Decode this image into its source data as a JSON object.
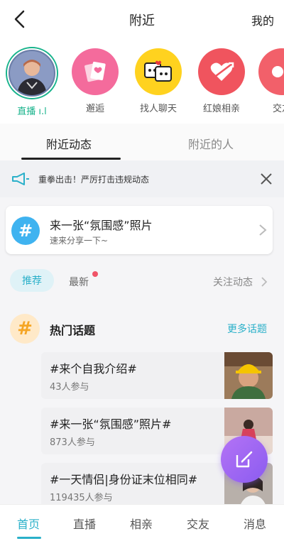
{
  "header": {
    "title": "附近",
    "mine_label": "我的"
  },
  "stories": [
    {
      "label": "直播 ı.l",
      "icon": "live-avatar"
    },
    {
      "label": "邂逅",
      "icon": "cards-icon"
    },
    {
      "label": "找人聊天",
      "icon": "chat-bubbles-icon"
    },
    {
      "label": "红娘相亲",
      "icon": "arrow-heart-icon"
    },
    {
      "label": "交友",
      "icon": "friends-icon"
    }
  ],
  "tabs": {
    "nearby_posts": "附近动态",
    "nearby_people": "附近的人"
  },
  "notice": {
    "text": "重拳出击！严厉打击违规动态"
  },
  "promo": {
    "title": "来一张“氛围感”照片",
    "subtitle": "速来分享一下~"
  },
  "filters": {
    "recommend": "推荐",
    "latest": "最新",
    "follow": "关注动态"
  },
  "hot_topics": {
    "title": "热门话题",
    "more": "更多话题",
    "items": [
      {
        "name": "#来个自我介绍#",
        "count": "43人参与"
      },
      {
        "name": "#来一张“氛围感”照片#",
        "count": "873人参与"
      },
      {
        "name": "#一天情侣|身份证末位相同#",
        "count": "119435人参与"
      }
    ]
  },
  "bottom_nav": [
    "首页",
    "直播",
    "相亲",
    "交友",
    "消息"
  ],
  "colors": {
    "accent": "#2ab0c9",
    "pink": "#f46b9c",
    "yellow": "#ffd21f",
    "red": "#f0545e",
    "purple": "#9b63f2"
  }
}
